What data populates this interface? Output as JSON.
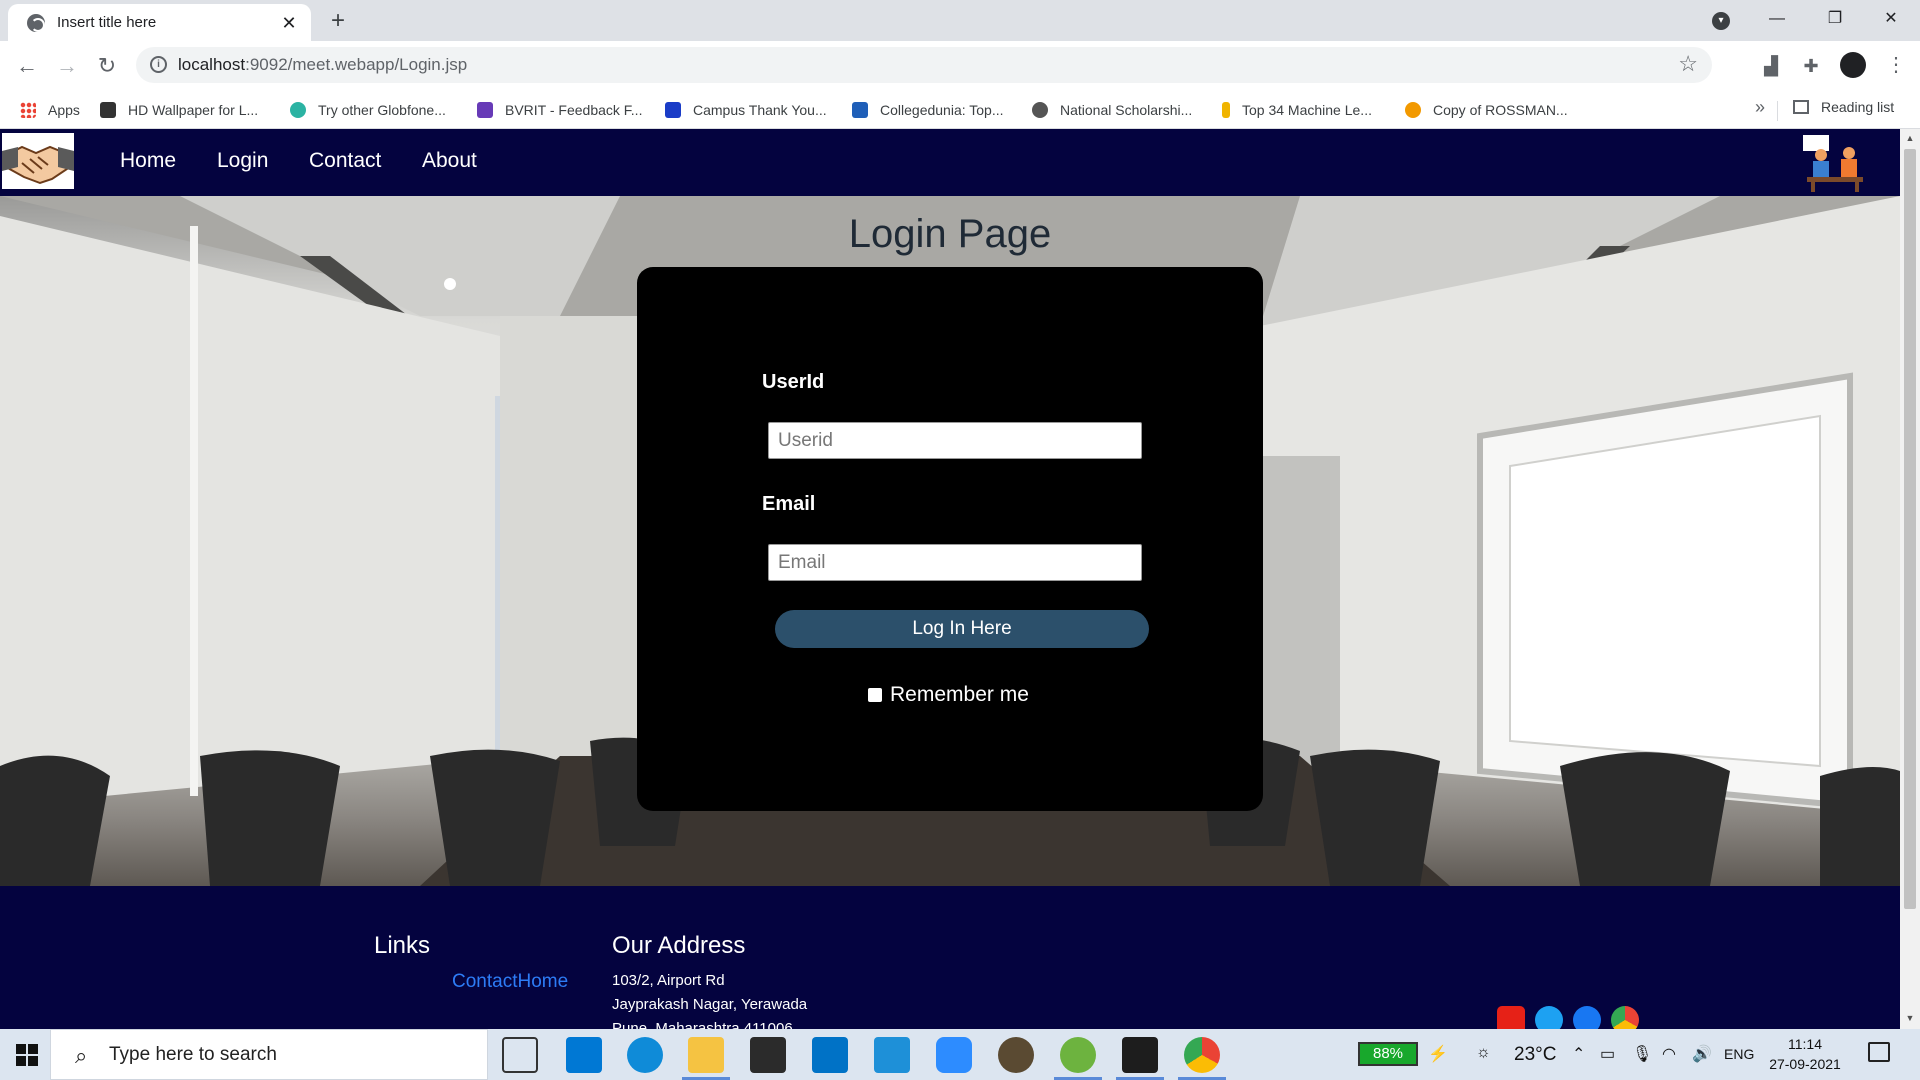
{
  "browser": {
    "tab_title": "Insert title here",
    "tab_close": "✕",
    "new_tab": "+",
    "url_host": "localhost",
    "url_rest": ":9092/meet.webapp/Login.jsp",
    "win_minimize": "—",
    "win_restore": "❐",
    "win_close": "✕",
    "bookmarks": [
      {
        "label": "Apps",
        "color": "#4285f4"
      },
      {
        "label": "HD Wallpaper for L...",
        "color": "#333333"
      },
      {
        "label": "Try other Globfone...",
        "color": "#2bb3a3"
      },
      {
        "label": "BVRIT - Feedback F...",
        "color": "#673ab7"
      },
      {
        "label": "Campus Thank You...",
        "color": "#1a3cc7"
      },
      {
        "label": "Collegedunia: Top...",
        "color": "#1f5fb8"
      },
      {
        "label": "National Scholarshi...",
        "color": "#555555"
      },
      {
        "label": "Top 34 Machine Le...",
        "color": "#f0b400"
      },
      {
        "label": "Copy of ROSSMAN...",
        "color": "#f29900"
      }
    ],
    "bookmarks_more": "»",
    "reading_list": "Reading list"
  },
  "site": {
    "nav": [
      "Home",
      "Login",
      "Contact",
      "About"
    ],
    "page_title": "Login Page",
    "form": {
      "userid_label": "UserId",
      "userid_placeholder": "Userid",
      "email_label": "Email",
      "email_placeholder": "Email",
      "submit_label": "Log In Here",
      "remember_label": "Remember me"
    },
    "footer": {
      "links_heading": "Links",
      "link_contact_home": "ContactHome",
      "address_heading": "Our Address",
      "address_lines": [
        "103/2, Airport Rd",
        "Jayprakash Nagar, Yerawada",
        "Pune, Maharashtra 411006"
      ]
    }
  },
  "taskbar": {
    "search_placeholder": "Type here to search",
    "battery": "88%",
    "temperature": "23°C",
    "language": "ENG",
    "time": "11:14",
    "date": "27-09-2021"
  },
  "colors": {
    "nav_background": "#04033f",
    "login_button": "#2c506b",
    "footer_link": "#2d7cf6"
  }
}
